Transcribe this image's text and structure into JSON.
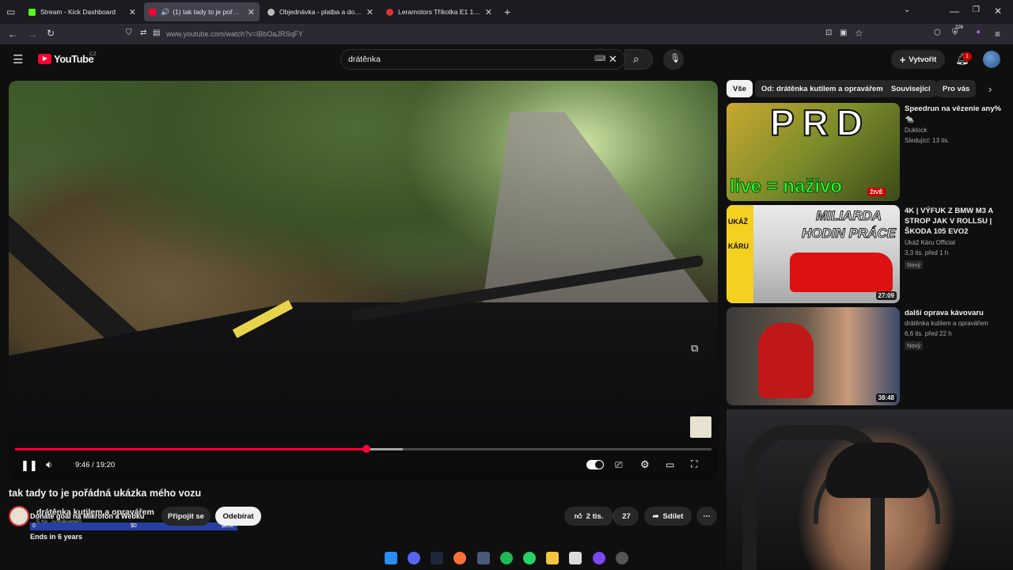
{
  "browser": {
    "tabs": [
      {
        "title": "Stream - Kick Dashboard",
        "active": false
      },
      {
        "title": "(1) tak tady to je pořádná ukázka",
        "active": true
      },
      {
        "title": "Objednávka - platba a doprava",
        "active": false
      },
      {
        "title": "Leramotors Tříkolka E1 1500W",
        "active": false
      }
    ],
    "url": "www.youtube.com/watch?v=IBbOaJRSqFY",
    "extension_badge": "226"
  },
  "youtube": {
    "logo": "YouTube",
    "country": "CZ",
    "search_value": "drátěnka",
    "create_label": "Vytvořit",
    "notification_count": "1"
  },
  "player": {
    "time_current": "9:46",
    "time_total": "19:20",
    "time_display": "9:46 / 19:20",
    "progress_percent": 50.5
  },
  "video": {
    "title": "tak tady to je pořádná ukázka mého vozu",
    "channel_name": "drátěnka kutilem a opravářem",
    "subscribers": "5 tis. odběratelů",
    "join_label": "Připojit se",
    "subscribe_label": "Odebírat",
    "likes": "2 tis.",
    "comments": "27",
    "share_label": "Sdílet"
  },
  "donate_overlay": {
    "text": "Donate goal na Mikrofon a Webku",
    "ticks": [
      "0",
      "$0",
      "$250"
    ],
    "ends": "Ends in 6 years"
  },
  "sidebar": {
    "chips": [
      "Vše",
      "Od: drátěnka kutilem a opravářem",
      "Související",
      "Pro vás"
    ],
    "videos": [
      {
        "title": "Speedrun na vězenie any% 🐀",
        "channel": "Duklock",
        "meta": "Sledující: 13 tis.",
        "badge": "ŽIVĚ",
        "thumb_text": "PRD",
        "thumb_sub": "live = naživo"
      },
      {
        "title": "4K | VÝFUK Z BMW M3 A STROP JAK V ROLLSU | ŠKODA 105 EVO2",
        "channel": "Ukáž Káru Official",
        "meta": "3,3 tis.  před 1 h",
        "new": "Nový",
        "duration": "27:09",
        "thumb_text": "MILIARDA HODIN PRÁCE",
        "thumb_side": "UKÁŽ KÁRU"
      },
      {
        "title": "další oprava kávovaru",
        "channel": "drátěnka kutilem a opravářem",
        "meta": "6,6 tis.  před 22 h",
        "new": "Nový",
        "duration": "38:48"
      }
    ]
  },
  "colors": {
    "accent": "#ff0033",
    "background": "#0f0f0f",
    "chip": "#272727",
    "goal_bar": "#2540a0"
  }
}
